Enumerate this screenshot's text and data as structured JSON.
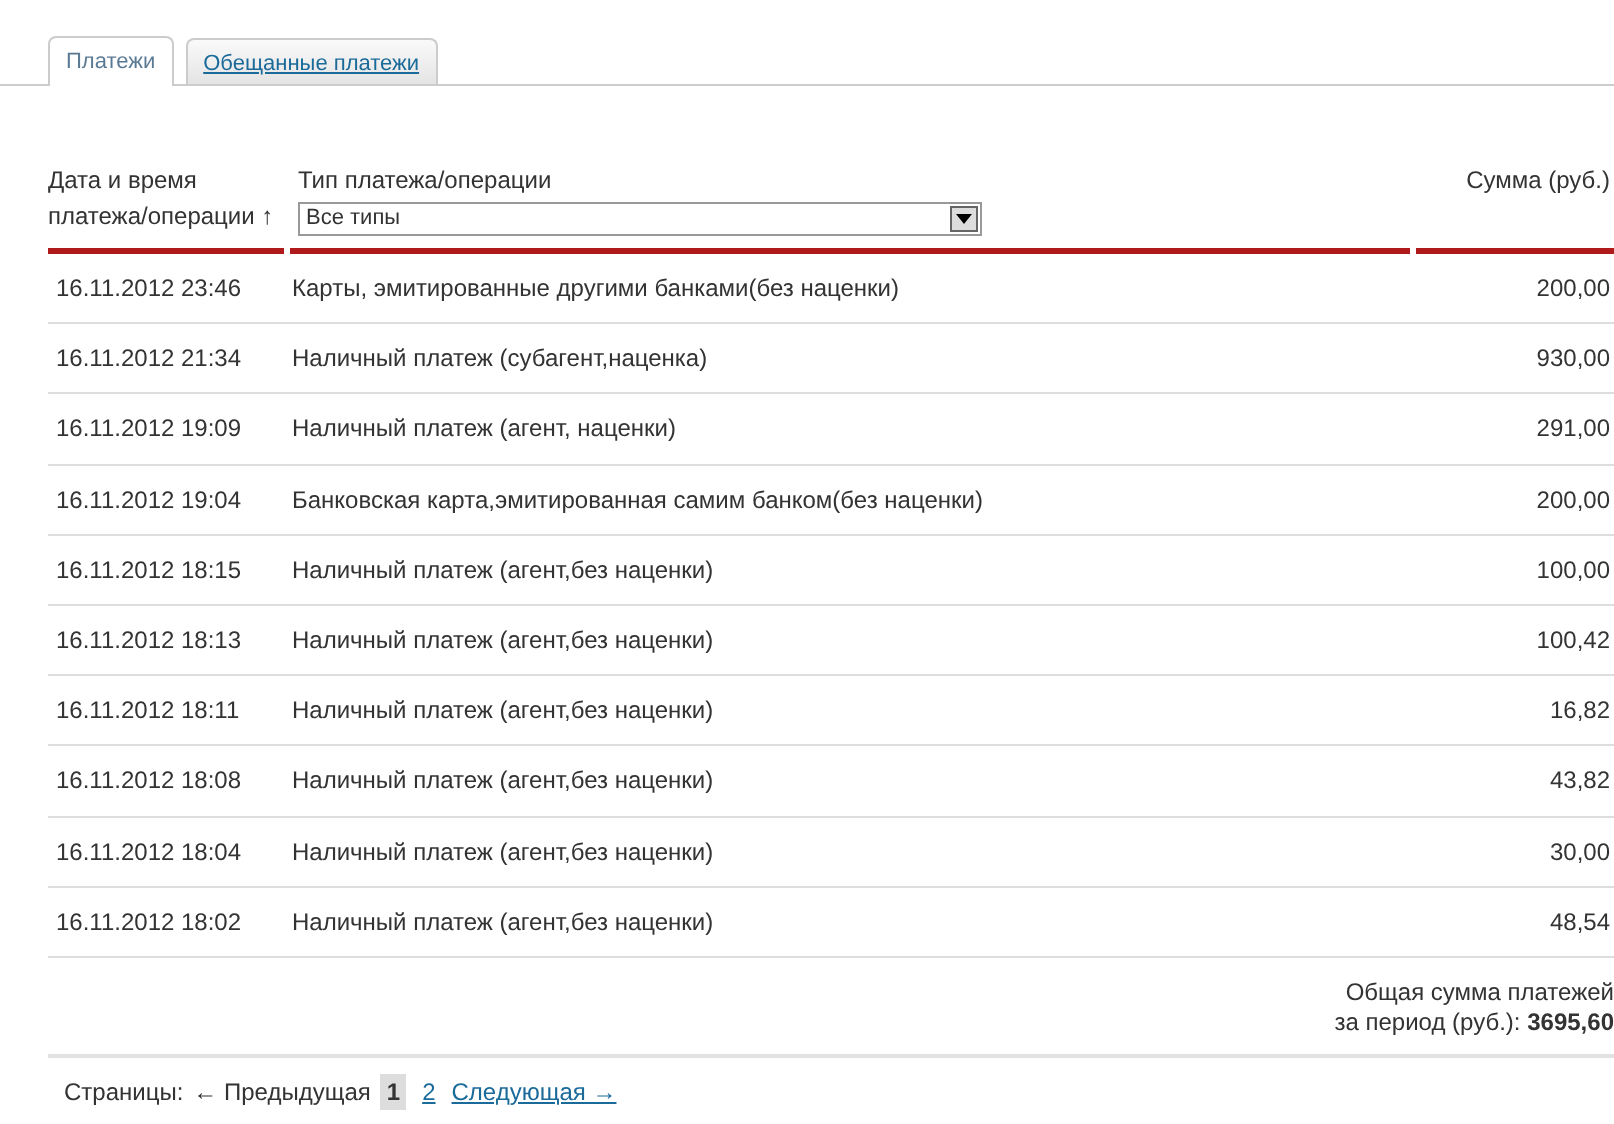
{
  "tabs": [
    {
      "label": "Платежи",
      "selected": true
    },
    {
      "label": "Обещанные платежи",
      "selected": false
    }
  ],
  "table": {
    "columns": [
      "Дата и время платежа/операции ↑",
      "Тип платежа/операции",
      "Сумма (руб.)"
    ],
    "type_filter": {
      "value": "Все типы"
    },
    "rows": [
      {
        "date": "16.11.2012 23:46",
        "type": "Карты, эмитированные другими банками(без наценки)",
        "amount": "200,00"
      },
      {
        "date": "16.11.2012 21:34",
        "type": "Наличный платеж (субагент,наценка)",
        "amount": "930,00"
      },
      {
        "date": "16.11.2012 19:09",
        "type": "Наличный платеж (агент, наценки)",
        "amount": "291,00"
      },
      {
        "date": "16.11.2012 19:04",
        "type": "Банковская карта,эмитированная самим банком(без наценки)",
        "amount": "200,00"
      },
      {
        "date": "16.11.2012 18:15",
        "type": "Наличный платеж (агент,без наценки)",
        "amount": "100,00"
      },
      {
        "date": "16.11.2012 18:13",
        "type": "Наличный платеж (агент,без наценки)",
        "amount": "100,42"
      },
      {
        "date": "16.11.2012 18:11",
        "type": "Наличный платеж (агент,без наценки)",
        "amount": "16,82"
      },
      {
        "date": "16.11.2012 18:08",
        "type": "Наличный платеж (агент,без наценки)",
        "amount": "43,82"
      },
      {
        "date": "16.11.2012 18:04",
        "type": "Наличный платеж (агент,без наценки)",
        "amount": "30,00"
      },
      {
        "date": "16.11.2012 18:02",
        "type": "Наличный платеж (агент,без наценки)",
        "amount": "48,54"
      }
    ]
  },
  "total": {
    "label": "Общая сумма платежей за период (руб.):",
    "value": "3695,60"
  },
  "pager": {
    "label": "Страницы:",
    "prev": "← Предыдущая",
    "pages": [
      {
        "label": "1",
        "selected": true
      },
      {
        "label": "2",
        "selected": false
      }
    ],
    "next": "Следующая →"
  }
}
